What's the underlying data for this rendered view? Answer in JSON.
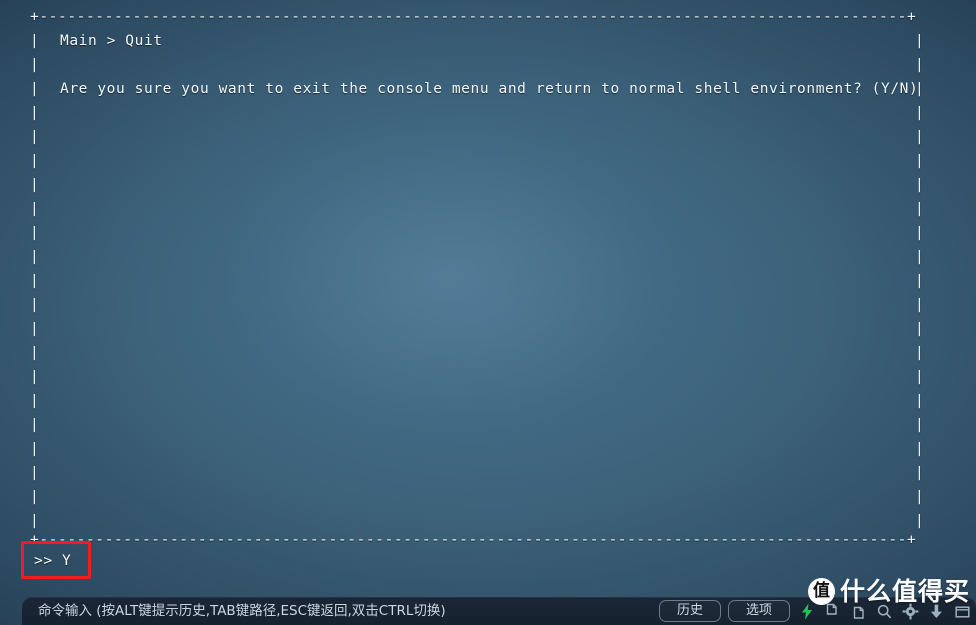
{
  "window": {
    "background_center": "#436a85",
    "background_edge": "#152232",
    "text_color": "#f2f6f8"
  },
  "terminal": {
    "top_border": "+---------------------------------------------------------------------------------------------+",
    "bottom_border": "+---------------------------------------------------------------------------------------------+",
    "left_edge": "|",
    "right_edge": "|",
    "breadcrumb": "Main > Quit",
    "message": "Are you sure you want to exit the console menu and return to normal shell environment? (Y/N)",
    "blank": "",
    "prompt": ">> Y",
    "prompt_symbol": ">>",
    "input_value": "Y"
  },
  "highlight": {
    "color": "#f01c24",
    "target": "prompt-input"
  },
  "statusbar": {
    "hint": "命令输入 (按ALT键提示历史,TAB键路径,ESC键返回,双击CTRL切换)",
    "buttons": [
      {
        "label": "历史",
        "name": "history-button"
      },
      {
        "label": "选项",
        "name": "options-button"
      }
    ],
    "icons": [
      {
        "name": "lightning-icon",
        "color": "#22c452"
      },
      {
        "name": "copy-icon",
        "color": "#9fb0bf"
      },
      {
        "name": "paste-icon",
        "color": "#9fb0bf"
      },
      {
        "name": "search-icon",
        "color": "#9fb0bf"
      },
      {
        "name": "gear-icon",
        "color": "#9fb0bf"
      },
      {
        "name": "download-icon",
        "color": "#9fb0bf"
      },
      {
        "name": "window-icon",
        "color": "#9fb0bf"
      }
    ]
  },
  "watermark": {
    "badge": "值",
    "text": "什么值得买"
  }
}
